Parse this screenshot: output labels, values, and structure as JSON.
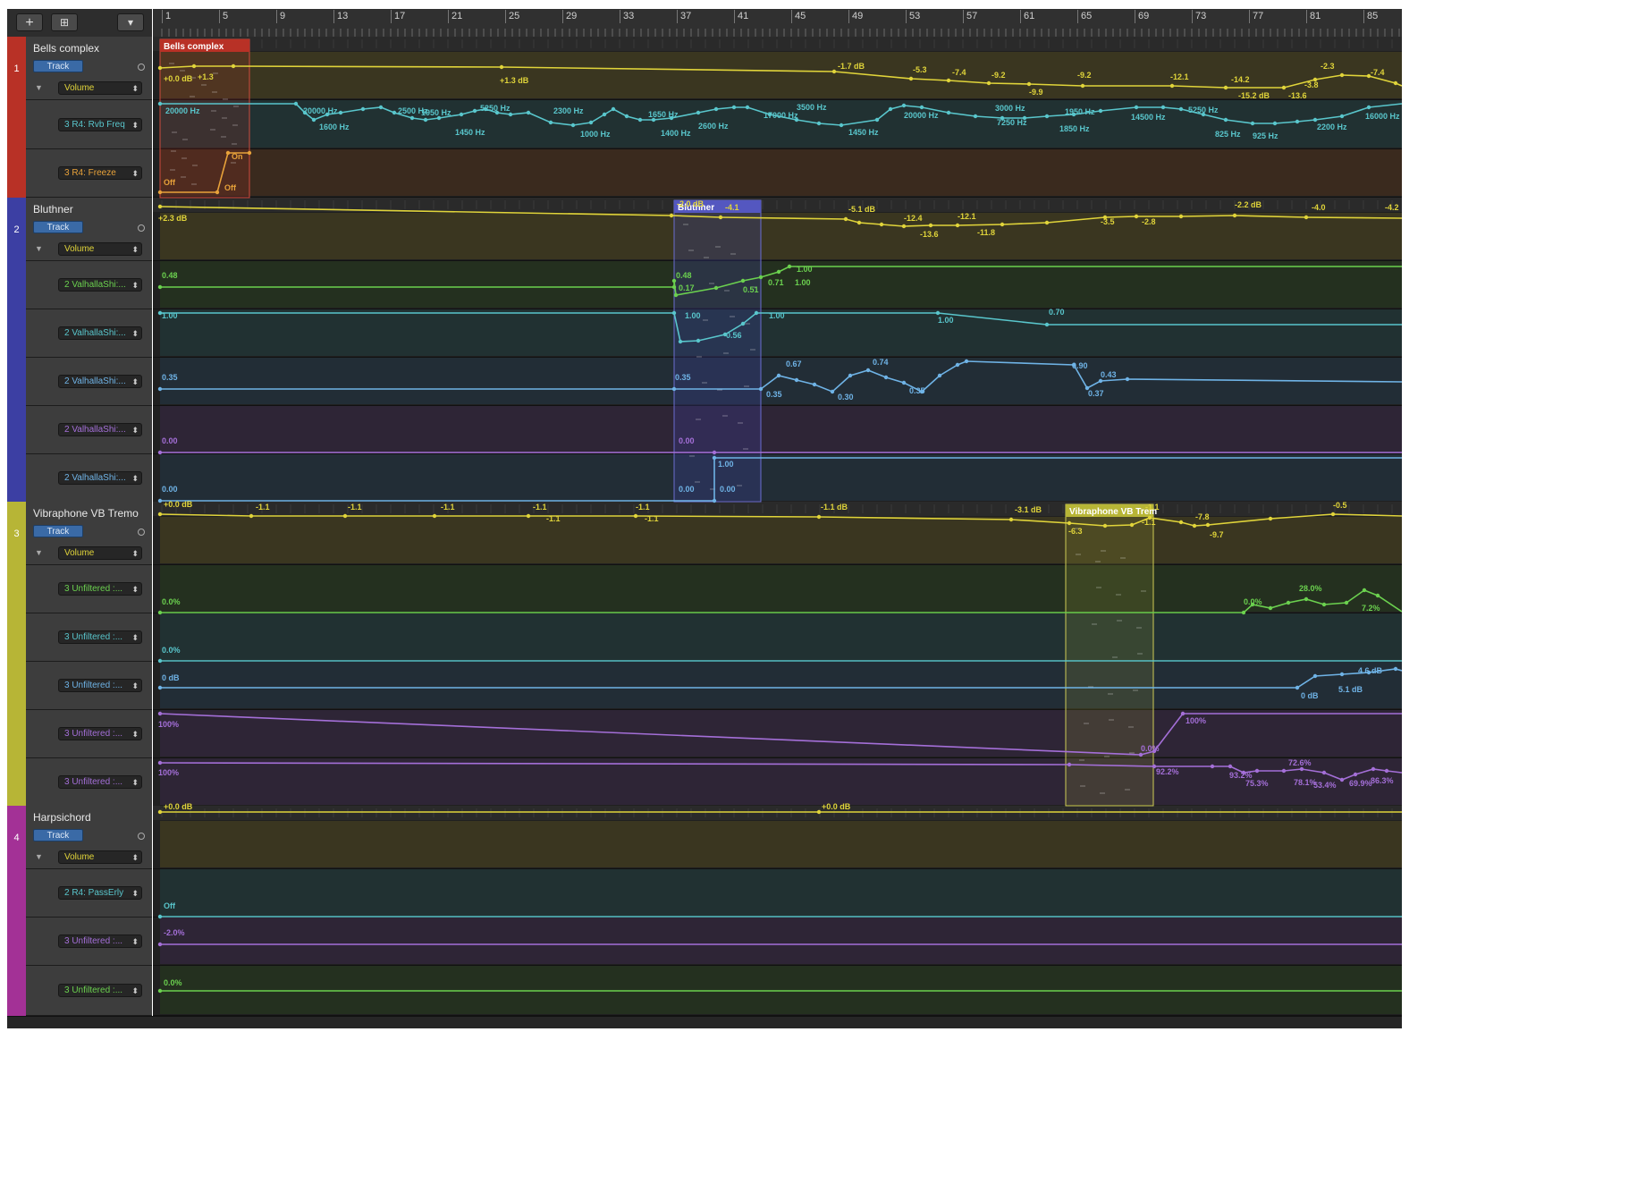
{
  "toolbar": {
    "add_label": "+",
    "folder_label": "⊞",
    "menu_label": "▾"
  },
  "ruler": {
    "bars": [
      "1",
      "5",
      "9",
      "13",
      "17",
      "21",
      "25",
      "29",
      "33",
      "37",
      "41",
      "45",
      "49",
      "53",
      "57",
      "61",
      "65",
      "69",
      "73",
      "77",
      "81",
      "85"
    ]
  },
  "colors": {
    "volume": "#e0d43a",
    "green": "#6bd14f",
    "cyan": "#59c6cc",
    "blue": "#6fb3e6",
    "purple": "#a46fd8",
    "orange": "#e8a23a",
    "track1": "#b83126",
    "track2": "#3c3fa3",
    "track3": "#b7b536",
    "track4": "#a33196"
  },
  "tracks": [
    {
      "number": "1",
      "name": "Bells complex",
      "track_label": "Track",
      "volume_label": "Volume",
      "params": [
        "3 R4: Rvb Freq",
        "3 R4: Freeze"
      ],
      "region": {
        "name": "Bells complex"
      }
    },
    {
      "number": "2",
      "name": "Bluthner",
      "track_label": "Track",
      "volume_label": "Volume",
      "params": [
        "2 ValhallaShi:...",
        "2 ValhallaShi:...",
        "2 ValhallaShi:...",
        "2 ValhallaShi:...",
        "2 ValhallaShi:..."
      ],
      "region": {
        "name": "Bluthner"
      }
    },
    {
      "number": "3",
      "name": "Vibraphone VB  Tremo",
      "track_label": "Track",
      "volume_label": "Volume",
      "params": [
        "3 Unfiltered :...",
        "3 Unfiltered :...",
        "3 Unfiltered :...",
        "3 Unfiltered :...",
        "3 Unfiltered :..."
      ],
      "region": {
        "name": "Vibraphone VB  Trem"
      }
    },
    {
      "number": "4",
      "name": "Harpsichord",
      "track_label": "Track",
      "volume_label": "Volume",
      "params": [
        "2 R4: PassErly",
        "3 Unfiltered :...",
        "3 Unfiltered :..."
      ],
      "region": {
        "name": ""
      }
    }
  ],
  "lanes": [
    {
      "color": "volume",
      "labels": [
        "+0.0 dB",
        "+1.3",
        "+1.3 dB",
        "-1.7 dB",
        "-5.3",
        "-7.4",
        "-9.2",
        "-9.9",
        "-9.2",
        "-12.1",
        "-14.2",
        "-15.2 dB",
        "-13.6",
        "-3.8",
        "-2.3",
        "-7.4"
      ]
    },
    {
      "color": "cyan",
      "labels": [
        "20000 Hz",
        "20000 Hz",
        "1600 Hz",
        "2500 Hz",
        "1950 Hz",
        "5250 Hz",
        "1450 Hz",
        "2300 Hz",
        "1000 Hz",
        "1650 Hz",
        "1400 Hz",
        "2600 Hz",
        "17000 Hz",
        "3500 Hz",
        "1450 Hz",
        "20000 Hz",
        "3000 Hz",
        "7250 Hz",
        "1950 Hz",
        "1850 Hz",
        "14500 Hz",
        "5250 Hz",
        "825 Hz",
        "925 Hz",
        "2200 Hz",
        "16000 Hz"
      ]
    },
    {
      "color": "orange",
      "labels": [
        "Off",
        "On",
        "Off"
      ]
    },
    {
      "color": "volume",
      "labels": [
        "+2.3 dB",
        "-2.0 dB",
        "-4.1",
        "-5.1 dB",
        "-12.4",
        "-13.6",
        "-12.1",
        "-11.8",
        "-3.5",
        "-2.8",
        "-2.2 dB",
        "-4.0",
        "-4.2"
      ]
    },
    {
      "color": "green",
      "labels": [
        "0.48",
        "0.48",
        "0.17",
        "0.51",
        "0.71",
        "1.00",
        "1.00"
      ]
    },
    {
      "color": "cyan",
      "labels": [
        "1.00",
        "1.00",
        "0.56",
        "1.00",
        "1.00",
        "0.70"
      ]
    },
    {
      "color": "blue",
      "labels": [
        "0.35",
        "0.35",
        "0.67",
        "0.35",
        "0.30",
        "0.74",
        "0.35",
        "0.90",
        "0.37",
        "0.43"
      ]
    },
    {
      "color": "purple",
      "labels": [
        "0.00",
        "0.00"
      ]
    },
    {
      "color": "blue",
      "labels": [
        "0.00",
        "0.00",
        "1.00",
        "0.00"
      ]
    },
    {
      "color": "volume",
      "labels": [
        "+0.0 dB",
        "-1.1",
        "-1.1",
        "-1.1",
        "-1.1",
        "-1.1",
        "-1.1",
        "-1.1",
        "-1.1 dB",
        "-3.1 dB",
        "-6.3",
        "-1.1",
        "-1.1",
        "-7.8",
        "-9.7",
        "-0.5"
      ]
    },
    {
      "color": "green",
      "labels": [
        "0.0%",
        "0.0%",
        "28.0%",
        "7.2%"
      ]
    },
    {
      "color": "cyan",
      "labels": [
        "0.0%"
      ]
    },
    {
      "color": "blue",
      "labels": [
        "0 dB",
        "0 dB",
        "5.1 dB",
        "4.6 dB"
      ]
    },
    {
      "color": "purple",
      "labels": [
        "100%",
        "0.0%",
        "100%"
      ]
    },
    {
      "color": "purple",
      "labels": [
        "100%",
        "92.2%",
        "93.2%",
        "75.3%",
        "72.6%",
        "78.1%",
        "53.4%",
        "69.9%",
        "86.3%"
      ]
    },
    {
      "color": "volume",
      "labels": [
        "+0.0 dB",
        "+0.0 dB"
      ]
    },
    {
      "color": "cyan",
      "labels": [
        "Off"
      ]
    },
    {
      "color": "purple",
      "labels": [
        "-2.0%"
      ]
    },
    {
      "color": "green",
      "labels": [
        "0.0%"
      ]
    }
  ]
}
